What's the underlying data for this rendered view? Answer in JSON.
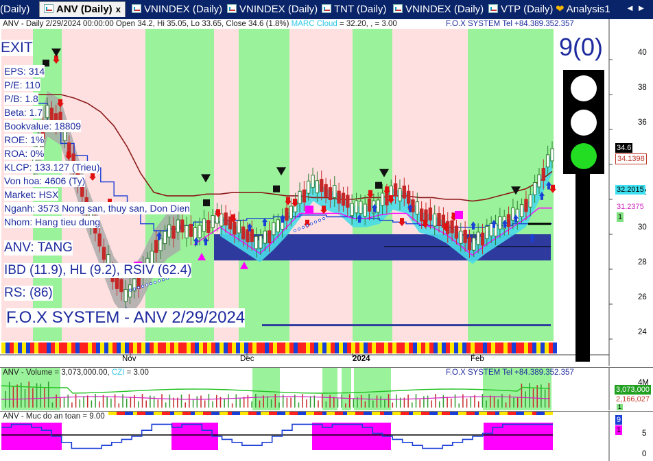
{
  "tabs": [
    {
      "label": "(Daily)"
    },
    {
      "label": "ANV (Daily)"
    },
    {
      "label": "VNINDEX (Daily)"
    },
    {
      "label": "VNINDEX (Daily)"
    },
    {
      "label": "TNT (Daily)"
    },
    {
      "label": "VNINDEX (Daily)"
    },
    {
      "label": "VTP (Daily)"
    },
    {
      "label": "Analysis1"
    }
  ],
  "tab_close": "x",
  "tab_nav": "◄ ►",
  "main": {
    "header_left": "ANV - Daily 2/29/2024 00:00:00 Open 34.2, Hi 35.05, Lo 33.65, Close 34.6 (1.8%)",
    "header_cloud": "MARC Cloud",
    "header_right": "= 32.20, , = 3.00",
    "header_brand": "F.O.X SYSTEM Tel +84.389.352.357",
    "exit": "EXIT",
    "info": [
      "EPS: 314",
      "P/E: 110",
      "P/B: 1.8",
      "Beta: 1.7",
      "Bookvalue: 18809",
      "ROE: 1%",
      "ROA: 0%",
      "KLCP: 133.127 (Trieu)",
      "Von hoa: 4606 (Ty)",
      "Market: HSX",
      "Nganh: 3573 Nong san, thuy san, Don Dien",
      "Nhom: Hang tieu dung"
    ],
    "trend": "ANV: TANG",
    "ibd": "IBD (11.9), HL (9.2), RSIV (62.4)",
    "rs": "RS:  (86)",
    "title_banner": "F.O.X SYSTEM - ANV 2/29/2024",
    "score": "9(0)",
    "y_ticks": [
      "40",
      "38",
      "36",
      "34",
      "32",
      "30",
      "28",
      "26",
      "24"
    ],
    "tags": [
      {
        "text": "34.6",
        "bg": "#000000",
        "fg": "#ffffff"
      },
      {
        "text": "34.1398",
        "bg": "#ffffff",
        "fg": "#c0392b"
      },
      {
        "text": "32.2015",
        "bg": "#3ee0f0",
        "fg": "#000000"
      },
      {
        "text": "31.2375",
        "bg": "#ffffff",
        "fg": "#d020c0"
      },
      {
        "text": "1",
        "bg": "#7ee07e",
        "fg": "#000000"
      }
    ],
    "x_labels": [
      "Nov",
      "Dec",
      "2024",
      "Feb"
    ]
  },
  "volume": {
    "header_left": "ANV - Volume = 3,073,000.00,",
    "header_czi": "CZI",
    "header_czi_val": "= 3.00",
    "header_brand": "F.O.X SYSTEM Tel +84.389.352.357",
    "y_tick": "4M",
    "tags": [
      {
        "text": "3,073,000",
        "bg": "#22a022",
        "fg": "#ffffff"
      },
      {
        "text": "2,166,027",
        "bg": "#ffffff",
        "fg": "#c0392b"
      },
      {
        "text": "1",
        "bg": "#7ee07e",
        "fg": "#000000"
      }
    ]
  },
  "safety": {
    "header_left": "ANV - Muc do an toan = 9.00",
    "y_ticks": [
      "5",
      "0"
    ],
    "tags": [
      {
        "text": "9",
        "bg": "#1a3fd6",
        "fg": "#ffffff"
      },
      {
        "text": "1",
        "bg": "#ff00ff",
        "fg": "#000000"
      }
    ]
  },
  "colors": {
    "green_zone": "#9af29a",
    "pink_zone": "#ffe0e0",
    "band": "#2e3a9e",
    "cloud": "#4adbe8",
    "up_candle": "#2e7d32",
    "down_candle": "#c62828",
    "magenta": "#ff00ff",
    "blue_line": "#1a3fd6",
    "brown_line": "#8b1a1a"
  },
  "chart_data": {
    "type": "candlestick",
    "symbol": "ANV",
    "interval": "Daily",
    "last": {
      "date": "2/29/2024",
      "open": 34.2,
      "high": 35.05,
      "low": 33.65,
      "close": 34.6,
      "change_pct": 1.8
    },
    "ylim": [
      23,
      41
    ],
    "path": [
      34,
      37,
      36.5,
      34,
      31.5,
      29.5,
      27.5,
      26.5,
      27.5,
      29,
      30,
      30.5,
      30,
      30.5,
      31,
      30.5,
      30,
      29.5,
      30.2,
      31,
      32,
      33,
      32.5,
      32.2,
      31.5,
      31.5,
      31.7,
      32.5,
      32.3,
      31.2,
      31,
      30.6,
      30,
      29.4,
      30,
      30.5,
      31,
      31.5,
      33,
      34.6
    ],
    "reference_lines": {
      "band_high": 30.0,
      "band_low": 28.5,
      "band_mid": 29.3,
      "banner_line": 24.8
    }
  }
}
